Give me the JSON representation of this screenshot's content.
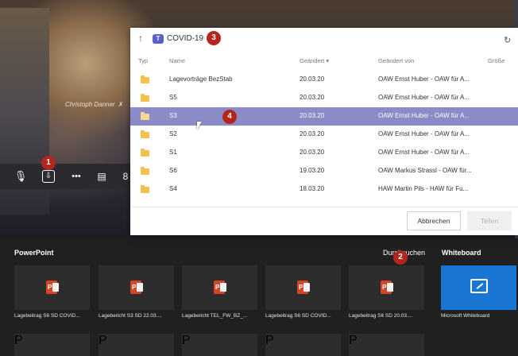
{
  "video": {
    "participant_name": "Christoph Danner"
  },
  "toolbar": {
    "mic_icon": "mic-off-icon",
    "share_icon": "share-tray-icon",
    "more": "•••",
    "chat_icon": "chat-icon"
  },
  "badges": {
    "b1": "1",
    "b2": "2",
    "b3": "3",
    "b4": "4"
  },
  "dialog": {
    "breadcrumb": "COVID-19",
    "columns": {
      "type": "Typ",
      "name": "Name",
      "changed": "Geändert ▾",
      "changed_by": "Geändert von",
      "size": "Größe"
    },
    "rows": [
      {
        "name": "Lagevorträge BezStab",
        "date": "20.03.20",
        "by": "OAW Ernst Huber - OAW für A..."
      },
      {
        "name": "S5",
        "date": "20.03.20",
        "by": "OAW Ernst Huber - OAW für A..."
      },
      {
        "name": "S3",
        "date": "20.03.20",
        "by": "OAW Ernst Huber - OAW für A...",
        "selected": true
      },
      {
        "name": "S2",
        "date": "20.03.20",
        "by": "OAW Ernst Huber - OAW für A..."
      },
      {
        "name": "S1",
        "date": "20.03.20",
        "by": "OAW Ernst Huber - OAW für A..."
      },
      {
        "name": "S6",
        "date": "19.03.20",
        "by": "OAW Markus Strassl - OAW für..."
      },
      {
        "name": "S4",
        "date": "18.03.20",
        "by": "HAW Martin Pils - HAW für Fu..."
      }
    ],
    "cancel_label": "Abbrechen",
    "share_label": "Teilen"
  },
  "tray": {
    "powerpoint_label": "PowerPoint",
    "browse_label": "Durchsuchen",
    "whiteboard_label": "Whiteboard",
    "tiles": [
      {
        "caption": "Lagebeitrag S6 SD COVID..."
      },
      {
        "caption": "Lagebericht S3 SD 22.03...."
      },
      {
        "caption": "Lagebericht TEL_FW_BZ_..."
      },
      {
        "caption": "Lagebeitrag S6 SD COVID..."
      },
      {
        "caption": "Lagebeitrag S6 SD 20.03...."
      }
    ],
    "whiteboard_caption": "Microsoft Whiteboard"
  },
  "colors": {
    "accent": "#8b8cc7",
    "badge": "#b3261e",
    "teams": "#5b5fc7",
    "whiteboard": "#1976d2",
    "ppt": "#d24726"
  }
}
